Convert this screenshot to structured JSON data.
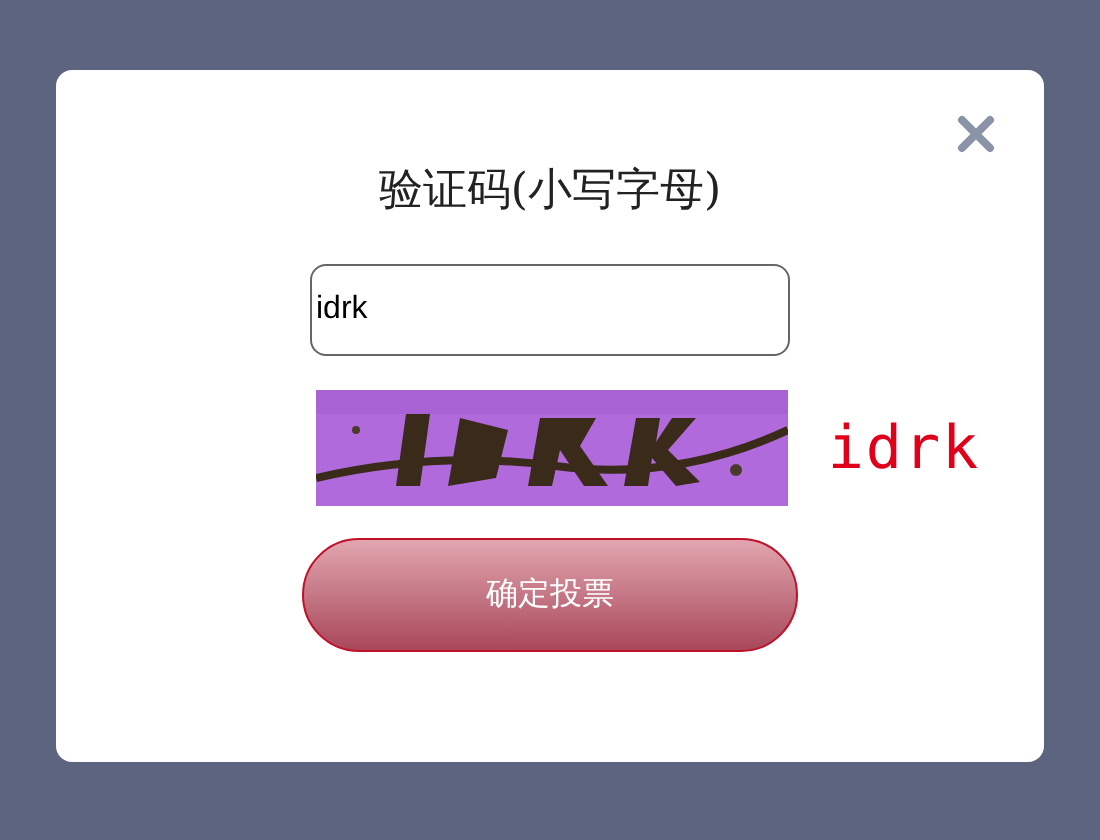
{
  "dialog": {
    "title": "验证码(小写字母)",
    "input": {
      "value": "idrk"
    },
    "captcha": {
      "kind": "picture",
      "hint": "idrk"
    },
    "button": {
      "label": "确定投票"
    }
  }
}
